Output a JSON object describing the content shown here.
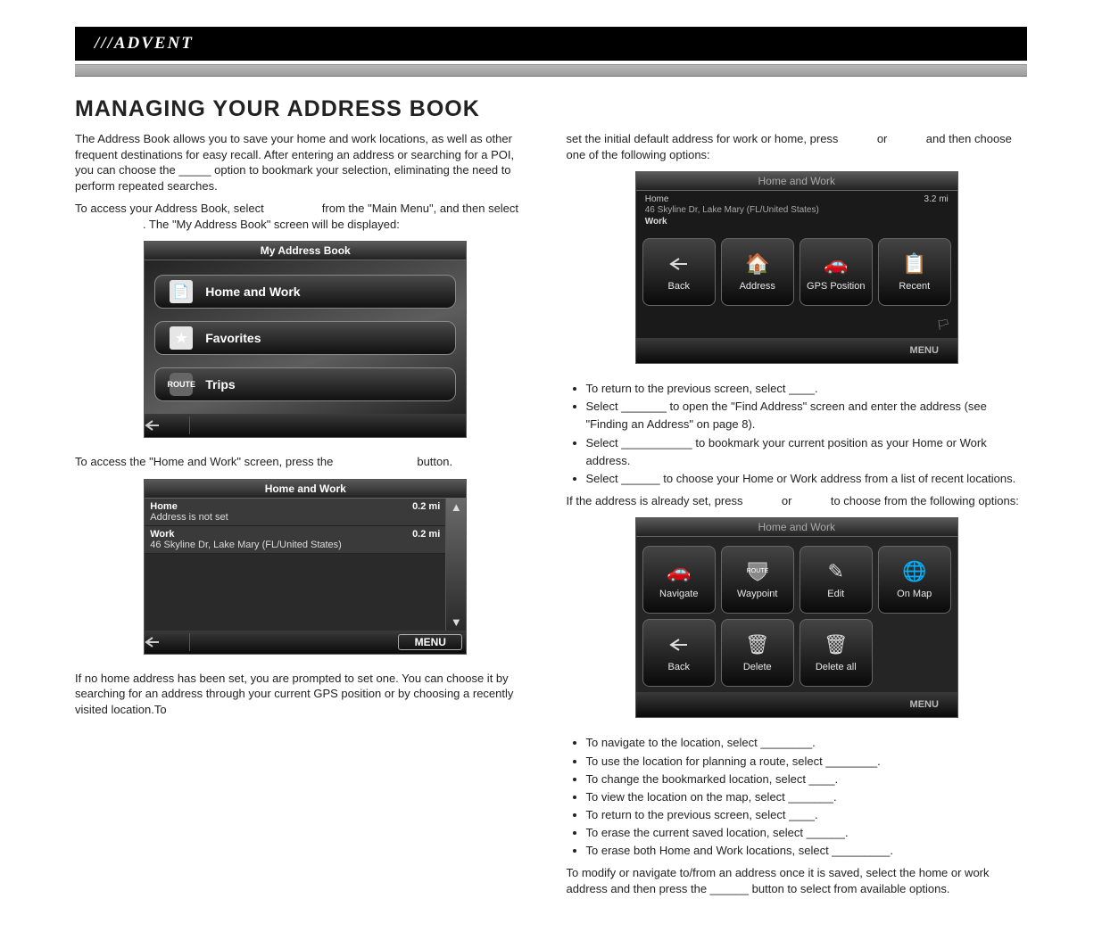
{
  "brand": "///ADVENT",
  "heading": "MANAGING YOUR ADDRESS BOOK",
  "left": {
    "p1": "The Address Book allows you to save your home and work locations, as well as other frequent destinations for easy recall. After entering an address or searching for a POI, you can choose the _____ option to bookmark your selection, eliminating the need to perform repeated searches.",
    "p2a": "To access your Address Book, select ",
    "p2b": " from the \"Main Menu\", and then select ",
    "p2c": ". The \"My Address Book\" screen will be displayed:",
    "p3a": "To access the \"Home and Work\" screen, press the ",
    "p3b": " button.",
    "p4": "If no home address has been set, you are prompted to set one. You can choose it by searching for an address through your current GPS position or by choosing a recently visited location.To "
  },
  "right": {
    "p1a": "set the initial default address for work or home, press ",
    "p1b": " or ",
    "p1c": " and then choose one of the following options:",
    "bullets1": {
      "b1": "To return to the previous screen, select ____.",
      "b2": "Select _______ to open the \"Find Address\" screen and enter the address (see \"Finding an Address\" on page 8).",
      "b3": "Select ___________ to bookmark your current position as your Home or Work address.",
      "b4": "Select ______ to choose your Home or Work address from a list of recent locations."
    },
    "p2a": "If the address is already set, press ",
    "p2b": " or ",
    "p2c": " to choose from the following options:",
    "bullets2": {
      "b1": "To navigate to the location, select ________.",
      "b2": "To use the location for planning a route, select ________.",
      "b3": "To change the bookmarked location, select ____.",
      "b4": "To view the location on the map, select _______.",
      "b5": "To return to the previous screen, select ____.",
      "b6": "To erase the current saved location, select ______.",
      "b7": "To erase both Home and Work locations, select _________."
    },
    "p3": "To modify or navigate to/from an address once it is saved, select the home or work address and then press the ______ button to select from available options."
  },
  "device1": {
    "title": "My Address Book",
    "items": [
      "Home and Work",
      "Favorites",
      "Trips"
    ]
  },
  "device2": {
    "title": "Home and Work",
    "rows": [
      {
        "label": "Home",
        "dist": "0.2 mi",
        "sub": "Address is not set"
      },
      {
        "label": "Work",
        "dist": "0.2 mi",
        "sub": "46 Skyline Dr, Lake Mary (FL/United States)"
      }
    ],
    "menu": "MENU"
  },
  "device3": {
    "title": "Home and Work",
    "top_label": "Home",
    "top_dist": "3.2 mi",
    "top_sub1": "46 Skyline Dr, Lake Mary (FL/United States)",
    "top_sub2": "Work",
    "buttons": [
      "Back",
      "Address",
      "GPS Position",
      "Recent"
    ],
    "menu": "MENU"
  },
  "device4": {
    "title": "Home and Work",
    "buttons_row1": [
      "Navigate",
      "Waypoint",
      "Edit",
      "On Map"
    ],
    "buttons_row2": [
      "Back",
      "Delete",
      "Delete all"
    ],
    "menu": "MENU"
  }
}
